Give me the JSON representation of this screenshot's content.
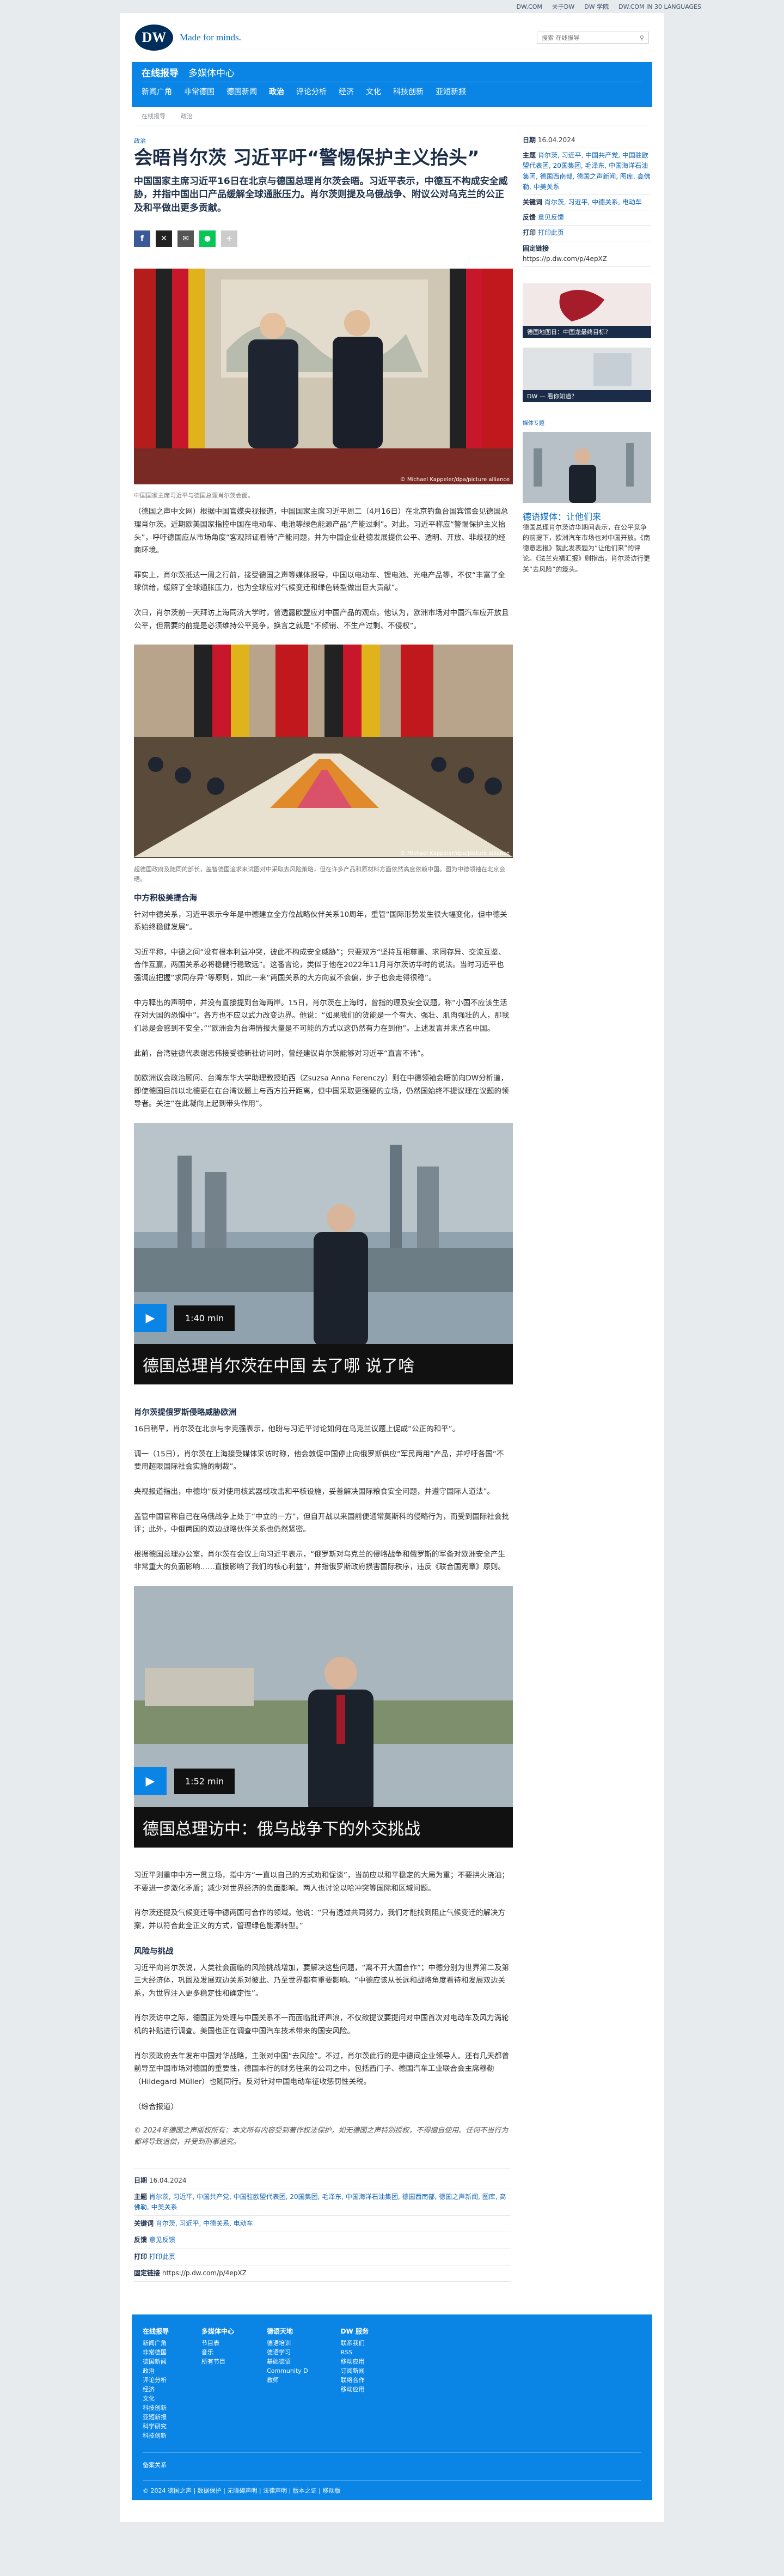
{
  "topbar": {
    "links": [
      "DW.COM",
      "关于DW",
      "DW 学院",
      "DW.COM IN 30 LANGUAGES"
    ]
  },
  "brand": {
    "logo": "DW",
    "tagline": "Made for minds.",
    "search_placeholder": "搜索 在线报导"
  },
  "nav": {
    "title": "在线报导",
    "sub": "多媒体中心",
    "items": [
      "新闻广角",
      "非常德国",
      "德国新闻",
      "政治",
      "评论分析",
      "经济",
      "文化",
      "科技创新",
      "亚短新报"
    ],
    "active": "政治"
  },
  "breadcrumb": [
    "在线报导",
    "政治"
  ],
  "article": {
    "kicker": "政治",
    "title": "会晤肖尔茨 习近平吁“警惕保护主义抬头”",
    "lead": "中国国家主席习近平16日在北京与德国总理肖尔茨会晤。习近平表示，中德互不构成安全威胁，并指中国出口产品缓解全球通胀压力。肖尔茨则提及乌俄战争、附议公对乌克兰的公正及和平做出更多贡献。",
    "img1_credit": "© Michael Kappeler/dpa/picture alliance",
    "img1_caption": "中国国家主席习近平与德国总理肖尔茨会面。",
    "p1": "（德国之声中文网）根据中国官媒央视报道，中国国家主席习近平周二（4月16日）在北京钓鱼台国宾馆会见德国总理肖尔茨。近期欧美国家指控中国在电动车、电池等绿色能源产品“产能过剩”。对此，习近平称应“警惕保护主义抬头”，呼吁德国应从市场角度“客观辩证看待”产能问题，并为中国企业赴德发展提供公平、透明、开放、非歧视的经商环境。",
    "p2": "罪实上，肖尔茨抵达一周之行前，接受德国之声等媒体报导，中国以电动车、锂电池、光电产品等，不仅“丰富了全球供给，缓解了全球通胀压力，也为全球应对气候变迁和绿色转型做出巨大贡献”。",
    "p3": "次日，肖尔茨前一天拜访上海同济大学时，曾透露欧盟应对中国产品的观点。他认为，欧洲市场对中国汽车应开放且公平，但需要的前提是必须维持公平竞争，换言之就是“不倾销、不生产过剩、不侵权”。",
    "img2_credit": "© Michael Kappeler/dpa/picture alliance",
    "img2_caption": "超德国政府及随同的部长，盖智德国追求来试图对中采取去风险策略，但在许多产品和原材料方面依然高度依赖中国。图为中德领袖在北京会晤。",
    "h_a": "中方积极美提合海",
    "p4": "针对中德关系，习近平表示今年是中德建立全方位战略伙伴关系10周年，重管“国际形势发生很大幅变化，但中德关系始终稳健发展”。",
    "p5": "习近平称，中德之间“没有根本利益冲突，彼此不构成安全威胁”；只要双方“坚持互相尊重、求同存异、交流互鉴、合作互赢，两国关系必将稳健行稳致远”。这番言论，类似于他在2022年11月肖尔茨访华时的说法。当时习近平也强调应把握“求同存异”等原则，如此一来“两国关系的大方向就不会偏，步子也会走得很稳”。",
    "p6": "中方释出的声明中，并没有直接提到台海两岸。15日，肖尔茨在上海时，曾指的理及安全议题，称“小国不应该生活在对大国的恐惧中”。各方也不应以武力改变边界。他说：“如果我们的货能是一个有大、强壮、肌肉强壮的人，那我们总是会感到不安全，”“欧洲会为台海情报大量是不可能的方式以这仍然有力在到他”。上述发言并未点名中国。",
    "p7": "此前，台湾驻德代表谢志伟接受德新社访问时，曾经建议肖尔茨能够对习近平“直言不讳”。",
    "p8": "前欧洲议会政治顾问、台湾东华大学助理教授珀西（Zsuzsa Anna Ferenczy）则在中德领袖会晤前向DW分析道，即使德国目前以北德更在在台湾议题上与西方拉开距离，但中国采取更强硬的立场，仍然国始终不提议理在议题的领导者。关注“在此凝向上起到带头作用”。",
    "video1": {
      "duration": "1:40 min",
      "title": "德国总理肖尔茨在中国 去了哪 说了啥"
    },
    "h_b": "肖尔茨提俄罗斯侵略威胁欧洲",
    "p9": "16日稍早，肖尔茨在北京与李克强表示，他盼与习近平讨论如何在乌克兰议题上促成“公正的和平”。",
    "p10": "调一（15日），肖尔茨在上海接受媒体采访时称，他会敦促中国停止向俄罗斯供应“军民两用”产品，并呼吁各国“不要用超限国际社会实施的制裁”。",
    "p11": "央视报道指出，中德均“反对使用核武器或攻击和平核设施，妥善解决国际粮食安全问题，并遵守国际人道法”。",
    "p12": "盖管中国官称自己在乌俄战争上处于“中立的一方”，但自开战以来国前便通常莫斯科的侵略行为，而受到国际社会批评；此外，中俄两国的双边战略伙伴关系也仍然紧密。",
    "p13": "根据德国总理办公室，肖尔茨在会议上向习近平表示，“俄罗斯对乌克兰的侵略战争和俄罗斯的军备对欧洲安全产生非常重大的负面影响……直接影响了我们的核心利益”，并指俄罗斯政府损害国际秩序，违反《联合国宪章》原则。",
    "video2": {
      "duration": "1:52 min",
      "title": "德国总理访中：俄乌战争下的外交挑战"
    },
    "p14": "习近平则重申中方一贯立场，指中方“一直以自己的方式劝和促谈”，当前应以和平稳定的大局为重；不要拱火浇油；不要进一步激化矛盾；减少对世界经济的负面影响。两人也讨论以哈冲突等国际和区域问题。",
    "p15": "肖尔茨还提及气候变迁等中德两国可合作的领域。他说：“只有透过共同努力，我们才能找到阻止气候变迁的解决方案，并以符合此全正义的方式，管理绿色能源转型。”",
    "h_c": "风险与挑战",
    "p16": "习近平向肖尔茨说，人类社会面临的风险挑战增加，要解决这些问题，“离不开大国合作”；中德分别为世界第二及第三大经济体，巩固及发展双边关系对彼此、乃至世界都有重要影响。“中德应该从长远和战略角度看待和发展双边关系，为世界注入更多稳定性和确定性”。",
    "p17": "肖尔茨访中之际，德国正为处理与中国关系不一而面临批评声浪，不仅欲提议要提问对中国首次对电动车及风力涡轮机的补贴进行调查。美国也正在调查中国汽车技术带来的国安风险。",
    "p18": "肖尔茨政府去年发布中国对华战略，主张对中国“去风险”。不过，肖尔茨此行的是中德间企业领导人。还有几天都曾前导至中国市场对德国的重要性，德国本行的财务往来的公司之中，包括西门子、德国汽车工业联合会主席穆勒（Hildegard Müller）也随同行。反对针对中国电动车征收惩罚性关税。",
    "p19": "（综合报道）",
    "copyright": "© 2024年德国之声版权所有：本文所有内容受到著作权法保护，如无德国之声特别授权，不得擅自使用。任何不当行为都将导致追偿，并受到刑事追究。"
  },
  "meta": {
    "date_label": "日期",
    "date": "16.04.2024",
    "topics_label": "主题",
    "topics": "肖尔茨, 习近平, 中国共产党, 中国驻欧盟代表团, 20国集团, 毛泽东, 中国海洋石油集团, 德国西南部, 德国之声新闻, 图库, 高佛勒, 中美关系",
    "kw_label": "关键词",
    "kw": "肖尔茨, 习近平, 中德关系, 电动车",
    "fb_label": "反馈",
    "fb": "意见反馈",
    "print_label": "打印",
    "print": "打印此页",
    "link_label": "固定链接",
    "link": "https://p.dw.com/p/4epXZ"
  },
  "aside": {
    "date_label": "日期",
    "date": "16.04.2024",
    "topics_label": "主题",
    "topics": "肖尔茨, 习近平, 中国共产党, 中国驻欧盟代表团, 20国集团, 毛泽东, 中国海洋石油集团, 德国西南部, 德国之声新闻, 图库, 高佛勒, 中美关系",
    "kw_label": "关键词",
    "kw": "肖尔茨, 习近平, 中德关系, 电动车",
    "fb_label": "反馈",
    "fb": "意见反馈",
    "print_label": "打印",
    "print": "打印此页",
    "link_label": "固定链接",
    "link": "https://p.dw.com/p/4epXZ",
    "ad1": "德国地图日：中国龙最终目标？",
    "ad2": "DW — 看你知道？",
    "sect": "媒体专题",
    "card_title": "德语媒体：让他们来",
    "card_desc": "德国总理肖尔茨访华期间表示，在公平竞争的前提下，欧洲汽车市场也对中国开放。《南德意志报》就此发表题为“让他们来”的评论。《法兰克福汇报》则指出，肖尔茨访行更关“去风险”的箴头。"
  },
  "footer": {
    "cols": [
      {
        "h": "在线报导",
        "items": [
          "新闻广角",
          "非常德国",
          "德国新闻",
          "政治",
          "评论分析",
          "经济",
          "文化",
          "科技创新",
          "亚短新报",
          "科学研究",
          "科技创新"
        ]
      },
      {
        "h": "多媒体中心",
        "items": [
          "节目表",
          "音乐",
          "所有节目"
        ]
      },
      {
        "h": "德语天地",
        "items": [
          "德语培训",
          "德语学习",
          "基础德语",
          "Community D",
          "教师"
        ]
      },
      {
        "h": "DW 服务",
        "items": [
          "联系我们",
          "RSS",
          "移动应用",
          "订阅新闻",
          "联络合作",
          "移动应用"
        ]
      }
    ],
    "sitemap": "备案关系",
    "bottom": "© 2024 德国之声 | 数据保护 | 无障碍声明 | 法律声明 | 版本之证 | 移动版"
  }
}
